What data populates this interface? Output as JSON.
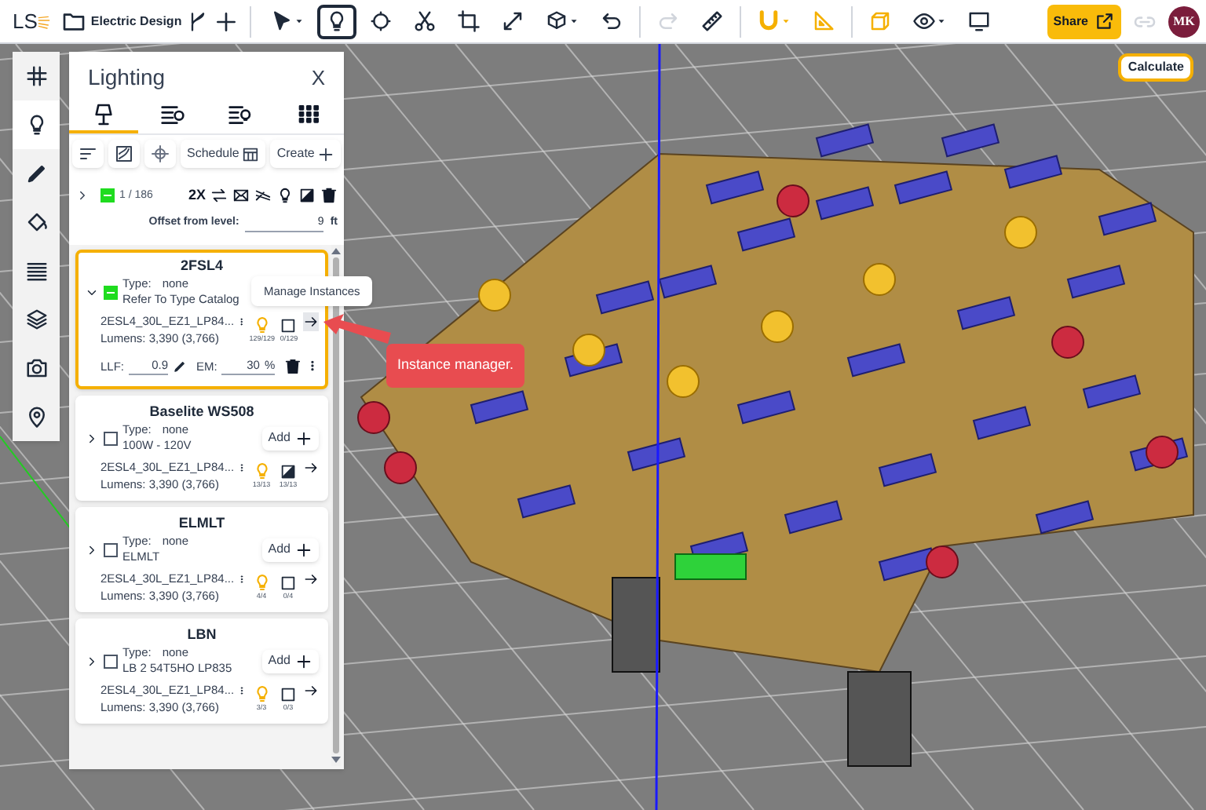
{
  "toolbar": {
    "logo": "LS",
    "project": "Electric Design",
    "tools": [
      {
        "selected": false,
        "disabled": false
      },
      {
        "selected": true,
        "disabled": false
      },
      {
        "selected": false,
        "disabled": false
      },
      {
        "selected": false,
        "disabled": false
      },
      {
        "selected": false,
        "disabled": false
      },
      {
        "selected": false,
        "disabled": false
      },
      {
        "selected": false,
        "disabled": false
      },
      {
        "selected": false,
        "disabled": false
      },
      {
        "selected": false,
        "disabled": true
      },
      {
        "selected": false,
        "disabled": false
      },
      {
        "selected": false,
        "disabled": false
      },
      {
        "selected": false,
        "disabled": false
      },
      {
        "selected": false,
        "disabled": false
      },
      {
        "selected": false,
        "disabled": false
      },
      {
        "selected": false,
        "disabled": false
      }
    ],
    "share": "Share",
    "avatar": "MK"
  },
  "viewport": {
    "calculate": "Calculate"
  },
  "tool_rail": [
    {
      "selected": false
    },
    {
      "selected": true
    },
    {
      "selected": false
    },
    {
      "selected": false
    },
    {
      "selected": false
    },
    {
      "selected": false
    },
    {
      "selected": false
    },
    {
      "selected": false
    }
  ],
  "panel": {
    "title": "Lighting",
    "close": "X",
    "tabs": [
      {
        "selected": true
      },
      {
        "selected": false
      },
      {
        "selected": false
      },
      {
        "selected": false
      }
    ],
    "schedule": "Schedule",
    "create": "Create",
    "summary": {
      "checked": true,
      "count": "1 / 186",
      "multiplier": "2X"
    },
    "offset": {
      "label": "Offset from level:",
      "value": "9",
      "unit": "ft"
    },
    "groups": [
      {
        "name": "2FSL4",
        "expanded": true,
        "selected": true,
        "checked": true,
        "type_label": "Type:",
        "type": "none",
        "description": "Refer To Type Catalog",
        "file": "2ESL4_30L_EZ1_LP84...",
        "lumens": "Lumens: 3,390 (3,766)",
        "placed": "129/129",
        "shaded": false,
        "status_count": "0/129",
        "llf_label": "LLF:",
        "llf": "0.9",
        "em_label": "EM:",
        "em": "30",
        "em_unit": "%"
      },
      {
        "name": "Baselite WS508",
        "expanded": false,
        "selected": false,
        "checked": false,
        "type_label": "Type:",
        "type": "none",
        "description": "100W - 120V",
        "add": "Add",
        "file": "2ESL4_30L_EZ1_LP84...",
        "lumens": "Lumens: 3,390 (3,766)",
        "placed": "13/13",
        "shaded": true,
        "status_count": "13/13"
      },
      {
        "name": "ELMLT",
        "expanded": false,
        "selected": false,
        "checked": false,
        "type_label": "Type:",
        "type": "none",
        "description": "ELMLT",
        "add": "Add",
        "file": "2ESL4_30L_EZ1_LP84...",
        "lumens": "Lumens: 3,390 (3,766)",
        "placed": "4/4",
        "shaded": false,
        "status_count": "0/4"
      },
      {
        "name": "LBN",
        "expanded": false,
        "selected": false,
        "checked": false,
        "type_label": "Type:",
        "type": "none",
        "description": "LB 2 54T5HO LP835",
        "add": "Add",
        "file": "2ESL4_30L_EZ1_LP84...",
        "lumens": "Lumens: 3,390 (3,766)",
        "placed": "3/3",
        "shaded": false,
        "status_count": "0/3"
      }
    ]
  },
  "callout": {
    "tooltip": "Manage Instances",
    "note": "Instance manager."
  }
}
